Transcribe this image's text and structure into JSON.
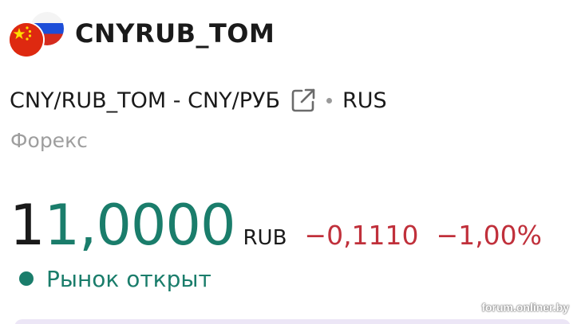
{
  "header": {
    "ticker": "CNYRUB_TOM",
    "flags": {
      "base_currency_icon": "china-flag-icon",
      "quote_currency_icon": "russia-flag-icon"
    }
  },
  "instrument": {
    "full_name": "CNY/RUB_TOM - CNY/РУБ",
    "external_link_icon": "external-link-icon",
    "exchange": "RUS"
  },
  "category": "Форекс",
  "quote": {
    "price_unchanged_part": "1",
    "price_changed_part": "1,0000",
    "currency": "RUB",
    "change_abs": "−0,1110",
    "change_pct": "−1,00%"
  },
  "market": {
    "status": "Рынок открыт"
  },
  "watermark": "forum.onliner.by",
  "colors": {
    "positive_green": "#1a7d6b",
    "negative_red": "#c0303b",
    "muted_gray": "#9e9e9e",
    "china_red": "#de2910",
    "china_gold": "#ffde00"
  }
}
